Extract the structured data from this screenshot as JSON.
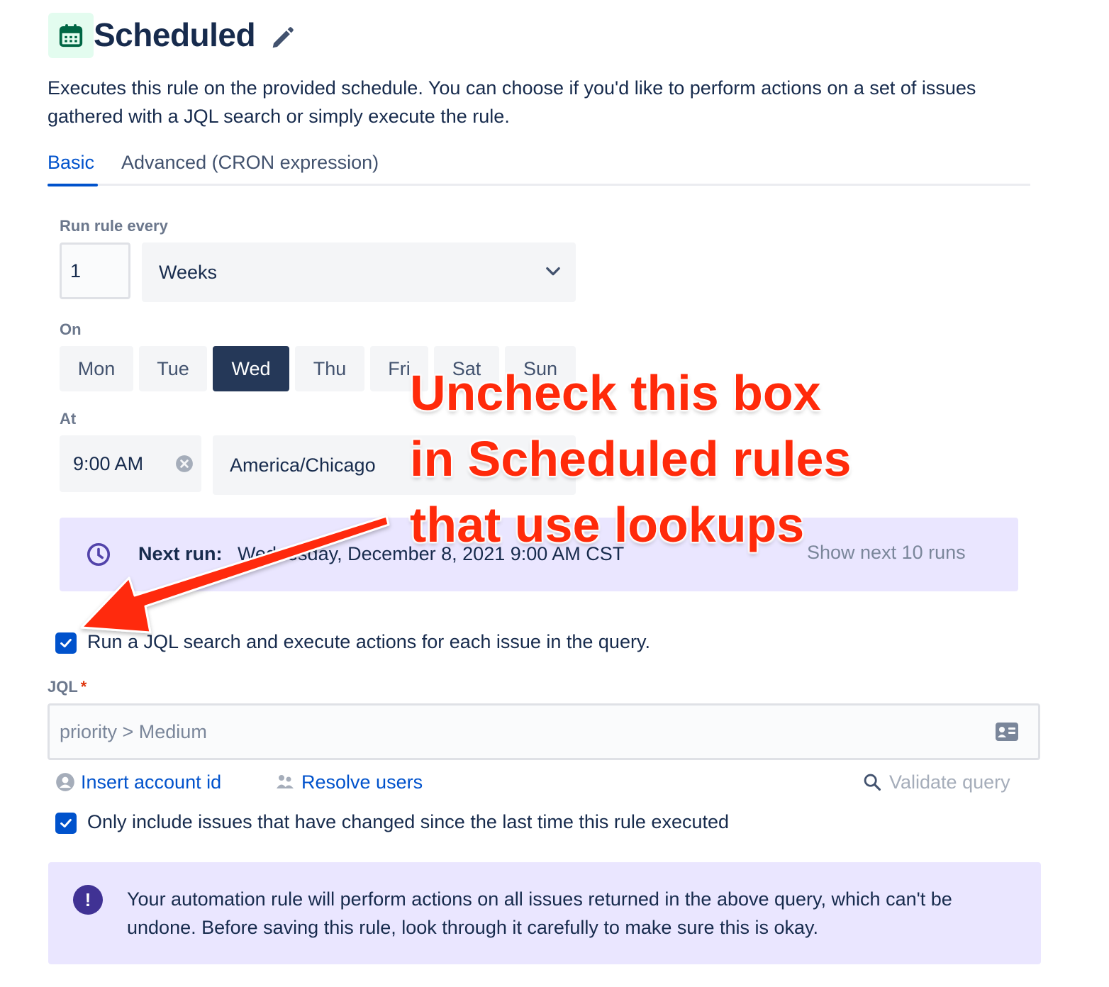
{
  "header": {
    "title": "Scheduled",
    "icon": "calendar-icon",
    "description": "Executes this rule on the provided schedule. You can choose if you'd like to perform actions on a set of issues gathered with a JQL search or simply execute the rule."
  },
  "tabs": [
    {
      "label": "Basic",
      "active": true
    },
    {
      "label": "Advanced (CRON expression)",
      "active": false
    }
  ],
  "schedule": {
    "run_every_label": "Run rule every",
    "interval_value": "1",
    "interval_unit": "Weeks",
    "on_label": "On",
    "days": [
      {
        "label": "Mon",
        "selected": false
      },
      {
        "label": "Tue",
        "selected": false
      },
      {
        "label": "Wed",
        "selected": true
      },
      {
        "label": "Thu",
        "selected": false
      },
      {
        "label": "Fri",
        "selected": false
      },
      {
        "label": "Sat",
        "selected": false
      },
      {
        "label": "Sun",
        "selected": false
      }
    ],
    "at_label": "At",
    "time": "9:00 AM",
    "timezone": "America/Chicago"
  },
  "next_run": {
    "label": "Next run:",
    "value": "Wednesday, December 8, 2021 9:00 AM CST",
    "show_more": "Show next 10 runs"
  },
  "jql_section": {
    "run_jql_checkbox": {
      "label": "Run a JQL search and execute actions for each issue in the query.",
      "checked": true
    },
    "jql_label": "JQL",
    "required_marker": "*",
    "jql_placeholder": "priority > Medium",
    "insert_account_id": "Insert account id",
    "resolve_users": "Resolve users",
    "validate_query": "Validate query",
    "only_changed_checkbox": {
      "label": "Only include issues that have changed since the last time this rule executed",
      "checked": true
    }
  },
  "warning": {
    "icon": "!",
    "text": "Your automation rule will perform actions on all issues returned in the above query, which can't be undone. Before saving this rule, look through it carefully to make sure this is okay."
  },
  "annotation": {
    "lines": [
      "Uncheck this box",
      "in Scheduled rules",
      "that use lookups"
    ],
    "color": "#FF2A0A"
  },
  "colors": {
    "primary": "#0052CC",
    "selected_day": "#253858",
    "panel": "#EAE6FF",
    "trigger_bg": "#E3FCEF",
    "trigger_icon": "#006644"
  }
}
